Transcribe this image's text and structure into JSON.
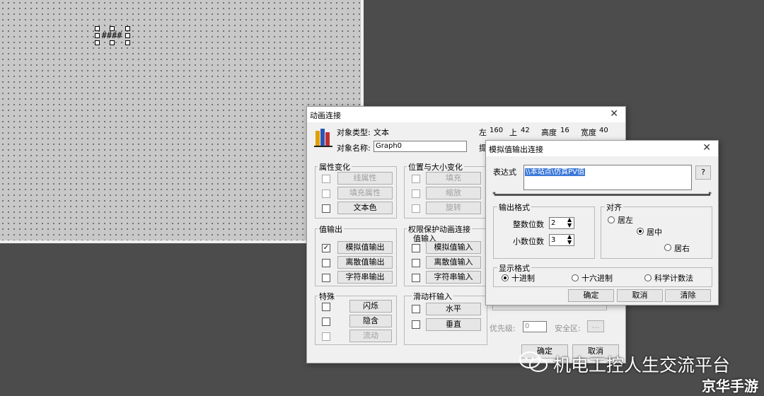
{
  "canvas": {
    "text_object": "####",
    "placeholder_chars": "?????"
  },
  "anim": {
    "title": "动画连接",
    "object_type_label": "对象类型:",
    "object_type_value": "文本",
    "object_name_label": "对象名称:",
    "object_name_value": "Graph0",
    "left_label": "左",
    "left_value": "160",
    "top_label": "上",
    "top_value": "42",
    "height_label": "高度",
    "height_value": "16",
    "width_label": "宽度",
    "width_value": "40",
    "hint_partial": "提",
    "attr_group": {
      "label": "属性变化",
      "items": [
        {
          "label": "线属性",
          "enabled": false
        },
        {
          "label": "填充属性",
          "enabled": false
        },
        {
          "label": "文本色",
          "enabled": true
        }
      ]
    },
    "pos_group": {
      "label": "位置与大小变化",
      "items": [
        {
          "label": "填充",
          "enabled": false
        },
        {
          "label": "缩放",
          "enabled": false
        },
        {
          "label": "旋转",
          "enabled": false
        }
      ]
    },
    "output_group": {
      "label": "值输出",
      "items": [
        {
          "label": "模拟值输出",
          "checked": true
        },
        {
          "label": "离散值输出",
          "checked": false
        },
        {
          "label": "字符串输出",
          "checked": false
        }
      ]
    },
    "perm_group": {
      "label": "权限保护动画连接",
      "sub_label": "值输入",
      "items": [
        {
          "label": "模拟值输入"
        },
        {
          "label": "离散值输入"
        },
        {
          "label": "字符串输入"
        }
      ]
    },
    "special_group": {
      "label": "特殊",
      "items": [
        {
          "label": "闪烁",
          "enabled": true
        },
        {
          "label": "隐含",
          "enabled": true
        },
        {
          "label": "流动",
          "enabled": false
        }
      ]
    },
    "slider_group": {
      "label": "滑动杆输入",
      "items": [
        {
          "label": "水平"
        },
        {
          "label": "垂直"
        }
      ]
    },
    "priority_label": "优先级:",
    "priority_value": "0",
    "security_label": "安全区:",
    "security_button": "...",
    "ok_label": "确定",
    "cancel_label": "取消"
  },
  "analog": {
    "title": "模拟值输出连接",
    "expr_label": "表达式",
    "expr_value": "\\\\本站点\\仿真PV值",
    "help_button": "?",
    "format_group": {
      "label": "输出格式",
      "int_label": "整数位数",
      "int_value": "2",
      "dec_label": "小数位数",
      "dec_value": "3"
    },
    "align_group": {
      "label": "对齐",
      "left": "居左",
      "center": "居中",
      "right": "居右",
      "selected": "center"
    },
    "display_group": {
      "label": "显示格式",
      "decimal": "十进制",
      "hex": "十六进制",
      "sci": "科学计数法",
      "selected": "decimal"
    },
    "ok_label": "确定",
    "cancel_label": "取消",
    "clear_label": "清除"
  },
  "watermark": {
    "channel": "机电工控人生交流平台",
    "site": "京华手游"
  }
}
